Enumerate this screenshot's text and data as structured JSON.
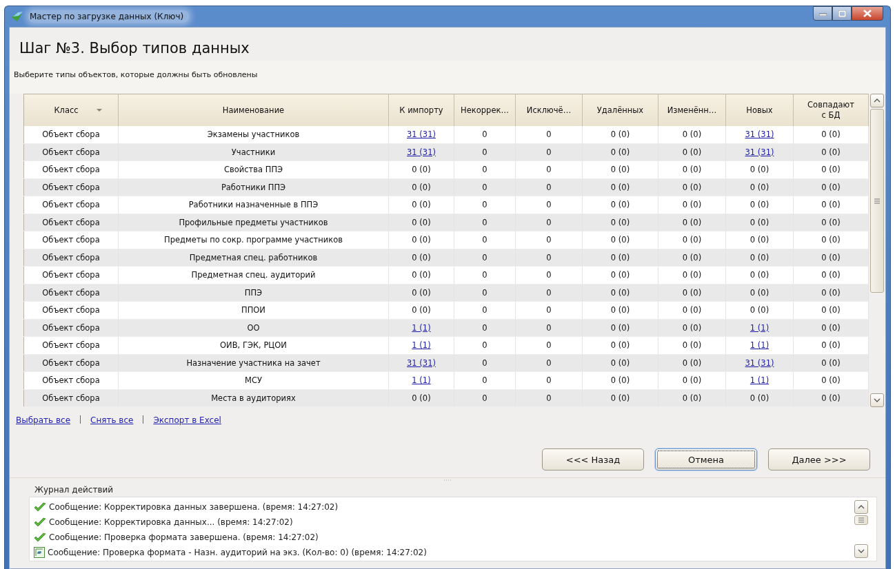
{
  "window": {
    "title": "Мастер по загрузке данных (Ключ)"
  },
  "heading": "Шаг №3.  Выбор типов данных",
  "subtitle": "Выберите типы объектов, которые должны быть обновлены",
  "table": {
    "columns": [
      {
        "label": "Класс",
        "sortable": true
      },
      {
        "label": "Наименование",
        "sortable": false
      },
      {
        "label": "К импорту",
        "sortable": false
      },
      {
        "label": "Некоррек…",
        "sortable": false
      },
      {
        "label": "Исключё…",
        "sortable": false
      },
      {
        "label": "Удалённых",
        "sortable": false
      },
      {
        "label": "Изменённ…",
        "sortable": false
      },
      {
        "label": "Новых",
        "sortable": false
      },
      {
        "label": "Совпадают с БД",
        "sortable": false
      }
    ],
    "rows": [
      {
        "class": "Объект сбора",
        "name": "Экзамены участников",
        "values": [
          {
            "text": "31 (31)",
            "link": true
          },
          {
            "text": "0",
            "link": false
          },
          {
            "text": "0",
            "link": false
          },
          {
            "text": "0 (0)",
            "link": false
          },
          {
            "text": "0 (0)",
            "link": false
          },
          {
            "text": "31 (31)",
            "link": true
          },
          {
            "text": "0 (0)",
            "link": false
          }
        ]
      },
      {
        "class": "Объект сбора",
        "name": "Участники",
        "values": [
          {
            "text": "31 (31)",
            "link": true
          },
          {
            "text": "0",
            "link": false
          },
          {
            "text": "0",
            "link": false
          },
          {
            "text": "0 (0)",
            "link": false
          },
          {
            "text": "0 (0)",
            "link": false
          },
          {
            "text": "31 (31)",
            "link": true
          },
          {
            "text": "0 (0)",
            "link": false
          }
        ]
      },
      {
        "class": "Объект сбора",
        "name": "Свойства ППЭ",
        "values": [
          {
            "text": "0 (0)",
            "link": false
          },
          {
            "text": "0",
            "link": false
          },
          {
            "text": "0",
            "link": false
          },
          {
            "text": "0 (0)",
            "link": false
          },
          {
            "text": "0 (0)",
            "link": false
          },
          {
            "text": "0 (0)",
            "link": false
          },
          {
            "text": "0 (0)",
            "link": false
          }
        ]
      },
      {
        "class": "Объект сбора",
        "name": "Работники ППЭ",
        "values": [
          {
            "text": "0 (0)",
            "link": false
          },
          {
            "text": "0",
            "link": false
          },
          {
            "text": "0",
            "link": false
          },
          {
            "text": "0 (0)",
            "link": false
          },
          {
            "text": "0 (0)",
            "link": false
          },
          {
            "text": "0 (0)",
            "link": false
          },
          {
            "text": "0 (0)",
            "link": false
          }
        ]
      },
      {
        "class": "Объект сбора",
        "name": "Работники назначенные в ППЭ",
        "values": [
          {
            "text": "0 (0)",
            "link": false
          },
          {
            "text": "0",
            "link": false
          },
          {
            "text": "0",
            "link": false
          },
          {
            "text": "0 (0)",
            "link": false
          },
          {
            "text": "0 (0)",
            "link": false
          },
          {
            "text": "0 (0)",
            "link": false
          },
          {
            "text": "0 (0)",
            "link": false
          }
        ]
      },
      {
        "class": "Объект сбора",
        "name": "Профильные предметы участников",
        "values": [
          {
            "text": "0 (0)",
            "link": false
          },
          {
            "text": "0",
            "link": false
          },
          {
            "text": "0",
            "link": false
          },
          {
            "text": "0 (0)",
            "link": false
          },
          {
            "text": "0 (0)",
            "link": false
          },
          {
            "text": "0 (0)",
            "link": false
          },
          {
            "text": "0 (0)",
            "link": false
          }
        ]
      },
      {
        "class": "Объект сбора",
        "name": "Предметы по сокр. программе участников",
        "values": [
          {
            "text": "0 (0)",
            "link": false
          },
          {
            "text": "0",
            "link": false
          },
          {
            "text": "0",
            "link": false
          },
          {
            "text": "0 (0)",
            "link": false
          },
          {
            "text": "0 (0)",
            "link": false
          },
          {
            "text": "0 (0)",
            "link": false
          },
          {
            "text": "0 (0)",
            "link": false
          }
        ]
      },
      {
        "class": "Объект сбора",
        "name": "Предметная спец. работников",
        "values": [
          {
            "text": "0 (0)",
            "link": false
          },
          {
            "text": "0",
            "link": false
          },
          {
            "text": "0",
            "link": false
          },
          {
            "text": "0 (0)",
            "link": false
          },
          {
            "text": "0 (0)",
            "link": false
          },
          {
            "text": "0 (0)",
            "link": false
          },
          {
            "text": "0 (0)",
            "link": false
          }
        ]
      },
      {
        "class": "Объект сбора",
        "name": "Предметная спец. аудиторий",
        "values": [
          {
            "text": "0 (0)",
            "link": false
          },
          {
            "text": "0",
            "link": false
          },
          {
            "text": "0",
            "link": false
          },
          {
            "text": "0 (0)",
            "link": false
          },
          {
            "text": "0 (0)",
            "link": false
          },
          {
            "text": "0 (0)",
            "link": false
          },
          {
            "text": "0 (0)",
            "link": false
          }
        ]
      },
      {
        "class": "Объект сбора",
        "name": "ППЭ",
        "values": [
          {
            "text": "0 (0)",
            "link": false
          },
          {
            "text": "0",
            "link": false
          },
          {
            "text": "0",
            "link": false
          },
          {
            "text": "0 (0)",
            "link": false
          },
          {
            "text": "0 (0)",
            "link": false
          },
          {
            "text": "0 (0)",
            "link": false
          },
          {
            "text": "0 (0)",
            "link": false
          }
        ]
      },
      {
        "class": "Объект сбора",
        "name": "ППОИ",
        "values": [
          {
            "text": "0 (0)",
            "link": false
          },
          {
            "text": "0",
            "link": false
          },
          {
            "text": "0",
            "link": false
          },
          {
            "text": "0 (0)",
            "link": false
          },
          {
            "text": "0 (0)",
            "link": false
          },
          {
            "text": "0 (0)",
            "link": false
          },
          {
            "text": "0 (0)",
            "link": false
          }
        ]
      },
      {
        "class": "Объект сбора",
        "name": "ОО",
        "values": [
          {
            "text": "1 (1)",
            "link": true
          },
          {
            "text": "0",
            "link": false
          },
          {
            "text": "0",
            "link": false
          },
          {
            "text": "0 (0)",
            "link": false
          },
          {
            "text": "0 (0)",
            "link": false
          },
          {
            "text": "1 (1)",
            "link": true
          },
          {
            "text": "0 (0)",
            "link": false
          }
        ]
      },
      {
        "class": "Объект сбора",
        "name": "ОИВ, ГЭК, РЦОИ",
        "values": [
          {
            "text": "1 (1)",
            "link": true
          },
          {
            "text": "0",
            "link": false
          },
          {
            "text": "0",
            "link": false
          },
          {
            "text": "0 (0)",
            "link": false
          },
          {
            "text": "0 (0)",
            "link": false
          },
          {
            "text": "1 (1)",
            "link": true
          },
          {
            "text": "0 (0)",
            "link": false
          }
        ]
      },
      {
        "class": "Объект сбора",
        "name": "Назначение участника на зачет",
        "values": [
          {
            "text": "31 (31)",
            "link": true
          },
          {
            "text": "0",
            "link": false
          },
          {
            "text": "0",
            "link": false
          },
          {
            "text": "0 (0)",
            "link": false
          },
          {
            "text": "0 (0)",
            "link": false
          },
          {
            "text": "31 (31)",
            "link": true
          },
          {
            "text": "0 (0)",
            "link": false
          }
        ]
      },
      {
        "class": "Объект сбора",
        "name": "МСУ",
        "values": [
          {
            "text": "1 (1)",
            "link": true
          },
          {
            "text": "0",
            "link": false
          },
          {
            "text": "0",
            "link": false
          },
          {
            "text": "0 (0)",
            "link": false
          },
          {
            "text": "0 (0)",
            "link": false
          },
          {
            "text": "1 (1)",
            "link": true
          },
          {
            "text": "0 (0)",
            "link": false
          }
        ]
      },
      {
        "class": "Объект сбора",
        "name": "Места в аудиториях",
        "values": [
          {
            "text": "0 (0)",
            "link": false
          },
          {
            "text": "0",
            "link": false
          },
          {
            "text": "0",
            "link": false
          },
          {
            "text": "0 (0)",
            "link": false
          },
          {
            "text": "0 (0)",
            "link": false
          },
          {
            "text": "0 (0)",
            "link": false
          },
          {
            "text": "0 (0)",
            "link": false
          }
        ]
      }
    ]
  },
  "links": [
    "Выбрать все",
    "Снять все",
    "Экспорт в Excel"
  ],
  "buttons": [
    {
      "label": "<<< Назад",
      "focused": false
    },
    {
      "label": "Отмена",
      "focused": true
    },
    {
      "label": "Далее >>>",
      "focused": false
    }
  ],
  "log": {
    "title": "Журнал действий",
    "entries": [
      {
        "kind": "ok",
        "text": "Сообщение: Корректировка данных завершена. (время: 14:27:02)"
      },
      {
        "kind": "ok",
        "text": "Сообщение: Корректировка данных... (время: 14:27:02)"
      },
      {
        "kind": "ok",
        "text": "Сообщение: Проверка формата завершена. (время: 14:27:02)"
      },
      {
        "kind": "code",
        "text": "Сообщение: Проверка формата - Назн. аудиторий на экз.  (Кол-во: 0) (время: 14:27:02)"
      }
    ]
  }
}
